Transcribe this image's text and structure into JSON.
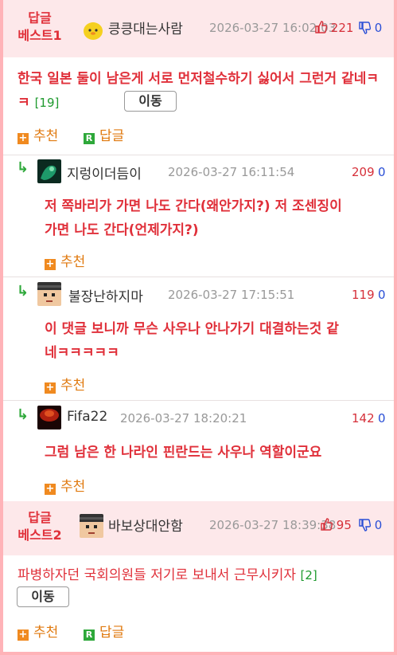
{
  "best1": {
    "label_line1": "답글",
    "label_line2": "베스트1",
    "nick": "킁킁대는사람",
    "date": "2026-03-27 16:02:03",
    "up": "221",
    "down": "0",
    "content": "한국 일본 둘이 남은게 서로 먼저철수하기 싫어서 그런거 같네ㅋㅋ",
    "reply_count": "[19]",
    "move_label": "이동",
    "recommend_label": "추천",
    "reply_label": "답글"
  },
  "replies": [
    {
      "nick": "지렁이더듬이",
      "date": "2026-03-27 16:11:54",
      "up": "209",
      "down": "0",
      "line1": "저 쪽바리가 가면 나도 간다(왜안가지?) 저 조센징이",
      "line2": "가면 나도 간다(언제가지?)",
      "recommend_label": "추천"
    },
    {
      "nick": "불장난하지마",
      "date": "2026-03-27 17:15:51",
      "up": "119",
      "down": "0",
      "line1": "이 댓글 보니까 무슨 사우나 안나가기 대결하는것 같",
      "line2": "네ㅋㅋㅋㅋㅋ",
      "recommend_label": "추천"
    },
    {
      "nick": "Fifa22",
      "date": "2026-03-27 18:20:21",
      "up": "142",
      "down": "0",
      "line1": "그럼 남은 한 나라인 핀란드는 사우나 역할이군요",
      "line2": "",
      "recommend_label": "추천"
    }
  ],
  "best2": {
    "label_line1": "답글",
    "label_line2": "베스트2",
    "nick": "바보상대안함",
    "date": "2026-03-27 18:39:38",
    "up": "95",
    "down": "0",
    "content": "파병하자던 국회의원들 저기로 보내서 근무시키자",
    "reply_count": "[2]",
    "move_label": "이동",
    "recommend_label": "추천",
    "reply_label": "답글"
  },
  "colors": {
    "accent_red": "#e0303a",
    "down_blue": "#2a4fd6",
    "count_green": "#1e9a2e",
    "action_orange": "#e07a10"
  }
}
